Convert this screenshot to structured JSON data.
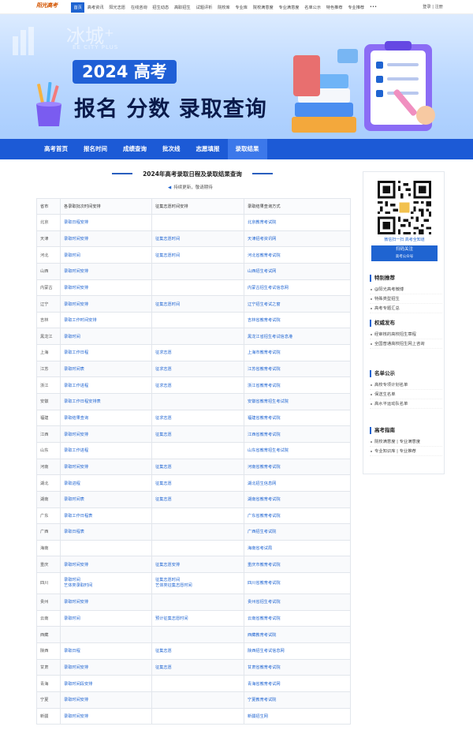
{
  "topnav": {
    "logo": "阳光高考",
    "links": [
      "首页",
      "高考资讯",
      "阳光志愿",
      "在线咨询",
      "招生动态",
      "高职招生",
      "试题评析",
      "院校库",
      "专业库",
      "院校满意度",
      "专业满意度",
      "名单公示",
      "特色推荐",
      "专业推荐",
      "•••"
    ],
    "active_index": 0,
    "login": "登录",
    "register": "注册",
    "login_sep": "|"
  },
  "banner": {
    "watermark": "冰城⁺",
    "watermark_sub": "EE CITY PLUS",
    "year_title": "2024 高考",
    "main_title": "报名 分数 录取查询"
  },
  "subnav": {
    "items": [
      "高考首页",
      "报名时间",
      "成绩查询",
      "批次线",
      "志愿填报",
      "录取结果"
    ],
    "active_index": 5
  },
  "section": {
    "title": "2024年高考录取日程及录取结果查询",
    "notice": "持续更新，敬请期待"
  },
  "table": {
    "headers": [
      "省市",
      "各录取批次时间安排",
      "征集志愿时间安排",
      "录取结果查询方式"
    ],
    "rows": [
      {
        "prov": "北京",
        "sched": "录取日程安排",
        "zj": "",
        "query": "北京教育考试院"
      },
      {
        "prov": "天津",
        "sched": "录取时间安排",
        "zj": "征集志愿时间",
        "query": "天津招考资讯网"
      },
      {
        "prov": "河北",
        "sched": "录取时间",
        "zj": "征集志愿时间",
        "query": "河北省教育考试院"
      },
      {
        "prov": "山西",
        "sched": "录取时间安排",
        "zj": "",
        "query": "山西招生考试网"
      },
      {
        "prov": "内蒙古",
        "sched": "录取时间安排",
        "zj": "",
        "query": "内蒙古招生考试信息网"
      },
      {
        "prov": "辽宁",
        "sched": "录取时间安排",
        "zj": "征集志愿时间",
        "query": "辽宁招生考试之窗"
      },
      {
        "prov": "吉林",
        "sched": "录取工作时间安排",
        "zj": "",
        "query": "吉林省教育考试院"
      },
      {
        "prov": "黑龙江",
        "sched": "录取时间",
        "zj": "",
        "query": "黑龙江省招生考试信息港"
      },
      {
        "prov": "上海",
        "sched": "录取工作日程",
        "zj": "征求志愿",
        "query": "上海市教育考试院"
      },
      {
        "prov": "江苏",
        "sched": "录取时间表",
        "zj": "征求志愿",
        "query": "江苏省教育考试院"
      },
      {
        "prov": "浙江",
        "sched": "录取工作进程",
        "zj": "征求志愿",
        "query": "浙江省教育考试院"
      },
      {
        "prov": "安徽",
        "sched": "录取工作日程安排表",
        "zj": "",
        "query": "安徽省教育招生考试院"
      },
      {
        "prov": "福建",
        "sched": "录取结果查询",
        "zj": "征求志愿",
        "query": "福建省教育考试院"
      },
      {
        "prov": "江西",
        "sched": "录取时间安排",
        "zj": "征集志愿",
        "query": "江西省教育考试院"
      },
      {
        "prov": "山东",
        "sched": "录取工作进程",
        "zj": "",
        "query": "山东省教育招生考试院"
      },
      {
        "prov": "河南",
        "sched": "录取时间安排",
        "zj": "征集志愿",
        "query": "河南省教育考试院"
      },
      {
        "prov": "湖北",
        "sched": "录取进程",
        "zj": "征集志愿",
        "query": "湖北招生信息网"
      },
      {
        "prov": "湖南",
        "sched": "录取时间表",
        "zj": "征集志愿",
        "query": "湖南省教育考试院"
      },
      {
        "prov": "广东",
        "sched": "录取工作日程表",
        "zj": "",
        "query": "广东省教育考试院"
      },
      {
        "prov": "广西",
        "sched": "录取日程表",
        "zj": "",
        "query": "广西招生考试院"
      },
      {
        "prov": "海南",
        "sched": "",
        "zj": "",
        "query": "海南省考试局"
      },
      {
        "prov": "重庆",
        "sched": "录取时间安排",
        "zj": "征集志愿安排",
        "query": "重庆市教育考试院"
      },
      {
        "prov": "四川",
        "sched": "录取时间",
        "sched2": "艺体类录取时间",
        "zj": "征集志愿时间",
        "zj2": "艺体类征集志愿时间",
        "query": "四川省教育考试院",
        "tall": true
      },
      {
        "prov": "贵州",
        "sched": "录取时间安排",
        "zj": "",
        "query": "贵州省招生考试院"
      },
      {
        "prov": "云南",
        "sched": "录取时间",
        "zj": "预计征集志愿时间",
        "query": "云南省教育考试院"
      },
      {
        "prov": "西藏",
        "sched": "",
        "zj": "",
        "query": "西藏教育考试院"
      },
      {
        "prov": "陕西",
        "sched": "录取日程",
        "zj": "征集志愿",
        "query": "陕西招生考试信息网"
      },
      {
        "prov": "甘肃",
        "sched": "录取时间安排",
        "zj": "征集志愿",
        "query": "甘肃省教育考试院"
      },
      {
        "prov": "青海",
        "sched": "录取时间段安排",
        "zj": "",
        "query": "青海省教育考试网"
      },
      {
        "prov": "宁夏",
        "sched": "录取时间安排",
        "zj": "",
        "query": "宁夏教育考试院"
      },
      {
        "prov": "新疆",
        "sched": "录取时间安排",
        "zj": "",
        "query": "新疆招生网"
      }
    ]
  },
  "sidebar": {
    "qr_caption": "微信扫一扫 高考全知道",
    "qr_button": "扫码关注",
    "qr_button_sub": "高考公众号",
    "sections": [
      {
        "title": "特别推荐",
        "items": [
          "@阳光高考微博",
          "特殊类型招生",
          "高考专题汇总"
        ]
      },
      {
        "title": "权威发布",
        "items": [
          "经审核的高校招生章程",
          "全国普通高校招生网上咨询"
        ]
      },
      {
        "title": "名单公示",
        "items": [
          "高校专项计划名单",
          "保送生名单",
          "高水平运动队名单"
        ]
      },
      {
        "title": "高考指南",
        "items": [
          "院校满意度 | 专业满意度",
          "专业知识库 | 专业推荐"
        ]
      }
    ]
  },
  "colors": {
    "primary": "#1f64d1",
    "subnav_bg": "#1c5ad6",
    "banner_top": "#dcebff",
    "banner_bottom": "#a9cdfd",
    "title_dark": "#0a1a4a"
  }
}
